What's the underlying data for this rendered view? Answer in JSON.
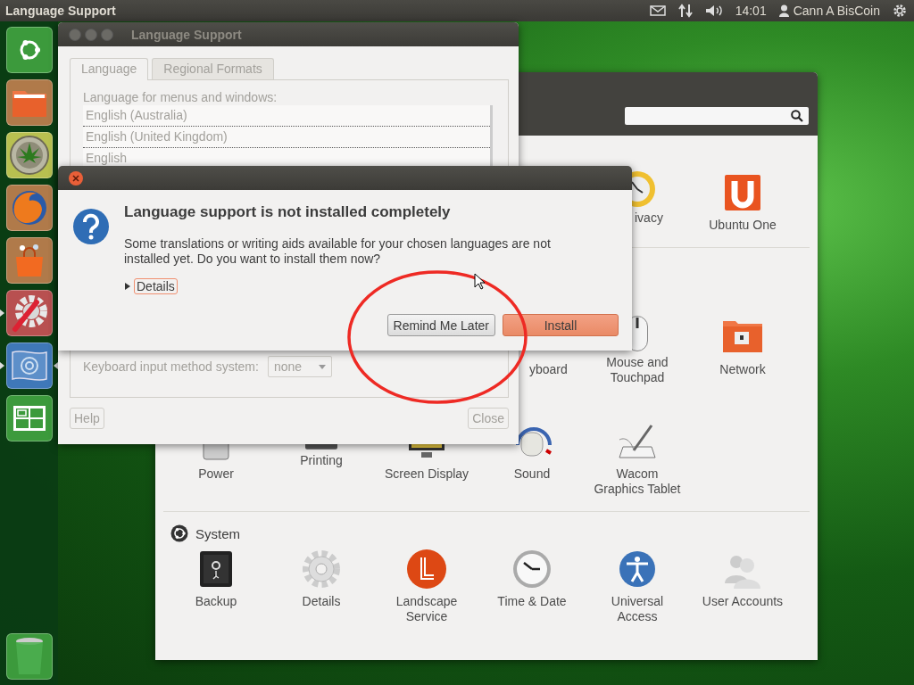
{
  "top_panel": {
    "title": "Language Support",
    "clock": "14:01",
    "user": "Cann A BisCoin"
  },
  "launcher": [
    {
      "kind": "dash",
      "running": false,
      "focused": false
    },
    {
      "kind": "files",
      "running": false,
      "focused": false
    },
    {
      "kind": "coin",
      "running": false,
      "focused": false
    },
    {
      "kind": "browser",
      "running": false,
      "focused": false
    },
    {
      "kind": "software",
      "running": false,
      "focused": false
    },
    {
      "kind": "settings",
      "running": true,
      "focused": false
    },
    {
      "kind": "language",
      "running": true,
      "focused": true
    },
    {
      "kind": "workspaces",
      "running": false,
      "focused": false
    },
    {
      "kind": "trash",
      "running": false,
      "focused": false
    }
  ],
  "settings_window": {
    "sections": [
      {
        "rows": [
          [
            "",
            "",
            "",
            "",
            {
              "label": "ivacy",
              "kind": "clock"
            },
            {
              "label": "Ubuntu One",
              "kind": "ubuntu-one"
            }
          ]
        ]
      },
      {
        "rows": [
          [
            "",
            "",
            "",
            {
              "label": "yboard",
              "kind": "keyboard"
            },
            {
              "label": "Mouse and Touchpad",
              "kind": "mouse"
            },
            {
              "label": "Network",
              "kind": "network"
            }
          ],
          [
            {
              "label": "Power",
              "kind": "power"
            },
            {
              "label": "Printing",
              "kind": "printer"
            },
            {
              "label": "Screen Display",
              "kind": "display"
            },
            {
              "label": "Sound",
              "kind": "sound"
            },
            {
              "label": "Wacom Graphics Tablet",
              "kind": "tablet"
            }
          ]
        ]
      },
      {
        "title": "System",
        "rows": [
          [
            {
              "label": "Backup",
              "kind": "safe"
            },
            {
              "label": "Details",
              "kind": "gear"
            },
            {
              "label": "Landscape Service",
              "kind": "landscape"
            },
            {
              "label": "Time & Date",
              "kind": "clock-face"
            },
            {
              "label": "Universal Access",
              "kind": "access"
            },
            {
              "label": "User Accounts",
              "kind": "users"
            }
          ]
        ]
      }
    ]
  },
  "language_window": {
    "title": "Language Support",
    "tabs": [
      {
        "label": "Language",
        "selected": true
      },
      {
        "label": "Regional Formats",
        "selected": false
      }
    ],
    "list_label": "Language for menus and windows:",
    "languages": [
      "English (Australia)",
      "English (United Kingdom)",
      "English"
    ],
    "input_method_label": "Keyboard input method system:",
    "input_method_value": "none",
    "buttons": [
      "Help",
      "Close"
    ]
  },
  "dialog": {
    "heading": "Language support is not installed completely",
    "message": "Some translations or writing aids available for your chosen languages are not installed yet. Do you want to install them now?",
    "details": "Details",
    "details_expanded": false,
    "buttons": [
      {
        "label": "Remind Me Later",
        "default": false
      },
      {
        "label": "Install",
        "default": true
      }
    ]
  }
}
